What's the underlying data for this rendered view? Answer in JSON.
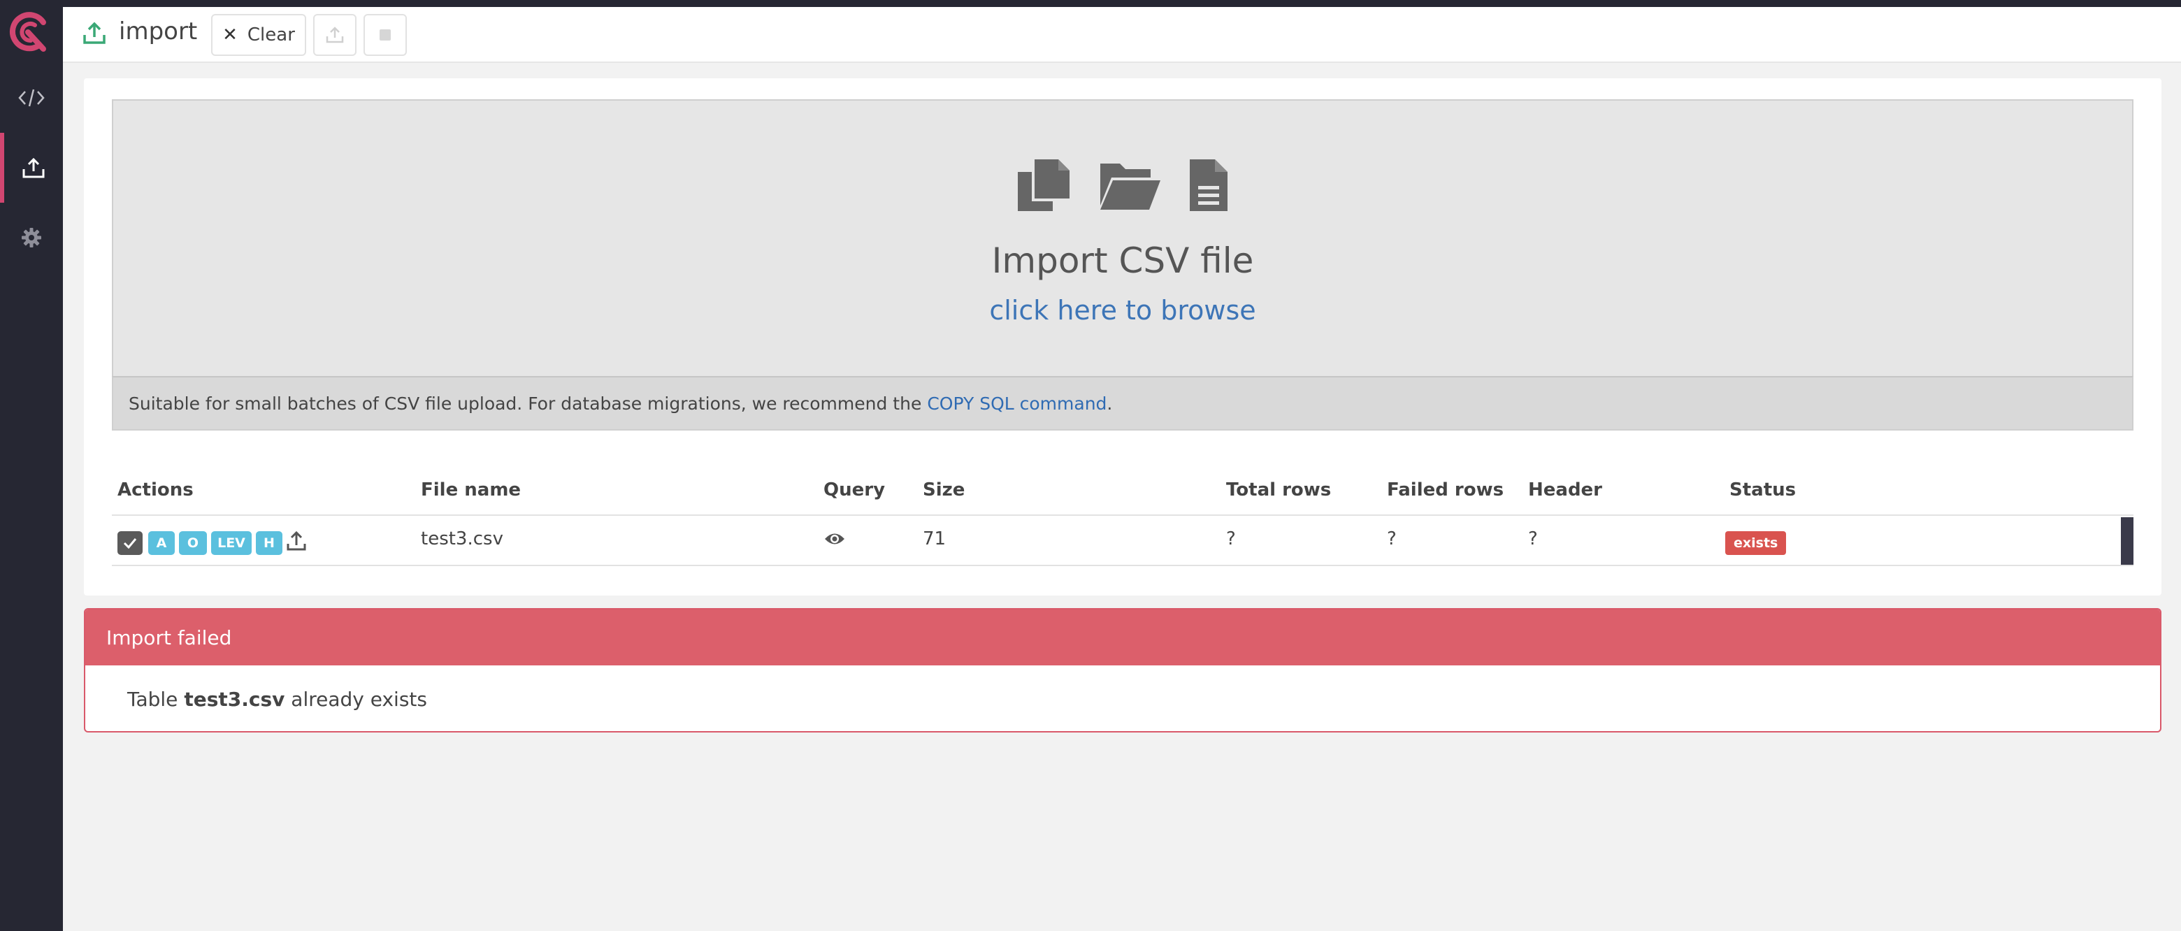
{
  "sidebar": {
    "items": [
      {
        "icon": "code-icon"
      },
      {
        "icon": "upload-icon",
        "active": true
      },
      {
        "icon": "gear-icon"
      }
    ]
  },
  "header": {
    "title": "import",
    "clear_label": "Clear"
  },
  "dropzone": {
    "title": "Import CSV file",
    "browse_text": "click here to browse"
  },
  "notice": {
    "text": "Suitable for small batches of CSV file upload. For database migrations, we recommend the",
    "link_text": "COPY SQL command",
    "suffix": "."
  },
  "table": {
    "columns": [
      "Actions",
      "File name",
      "Query",
      "Size",
      "Total rows",
      "Failed rows",
      "Header",
      "Status"
    ],
    "rows": [
      {
        "actions": [
          "A",
          "O",
          "LEV",
          "H"
        ],
        "file_name": "test3.csv",
        "size": "71",
        "total_rows": "?",
        "failed_rows": "?",
        "header": "?",
        "status": "exists"
      }
    ]
  },
  "alert": {
    "title": "Import failed",
    "prefix": "Table",
    "table_name": "test3.csv",
    "suffix": "already exists"
  },
  "colors": {
    "sidebar": "#262733",
    "brand": "#d14671",
    "link": "#3d75b7",
    "tag": "#5bc0de",
    "danger": "#d9534f",
    "alert_header": "#dc5f6b"
  }
}
